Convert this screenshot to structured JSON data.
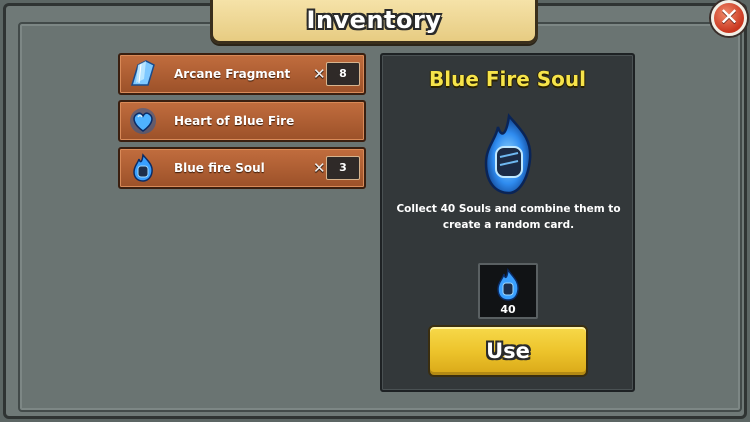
{
  "title": "Inventory",
  "close": {
    "glyph": "✕",
    "icon": "close-icon"
  },
  "items": [
    {
      "label": "Arcane Fragment",
      "count": "8",
      "icon": "crystal-shard-icon",
      "count_prefix": "✕"
    },
    {
      "label": "Heart of Blue Fire",
      "count": "",
      "icon": "blue-heart-icon",
      "count_prefix": ""
    },
    {
      "label": "Blue fire Soul",
      "count": "3",
      "icon": "blue-fire-soul-icon",
      "count_prefix": "✕"
    }
  ],
  "detail": {
    "title": "Blue Fire Soul",
    "description": "Collect 40 Souls and combine them to create a random card.",
    "required_count": "40",
    "use_label": "Use",
    "icon": "blue-fire-soul-icon"
  },
  "colors": {
    "title_yellow": "#f7e44a",
    "item_bg": "#b0603a",
    "use_button": "#edc42c",
    "blue_fire": "#3aa0ff"
  }
}
